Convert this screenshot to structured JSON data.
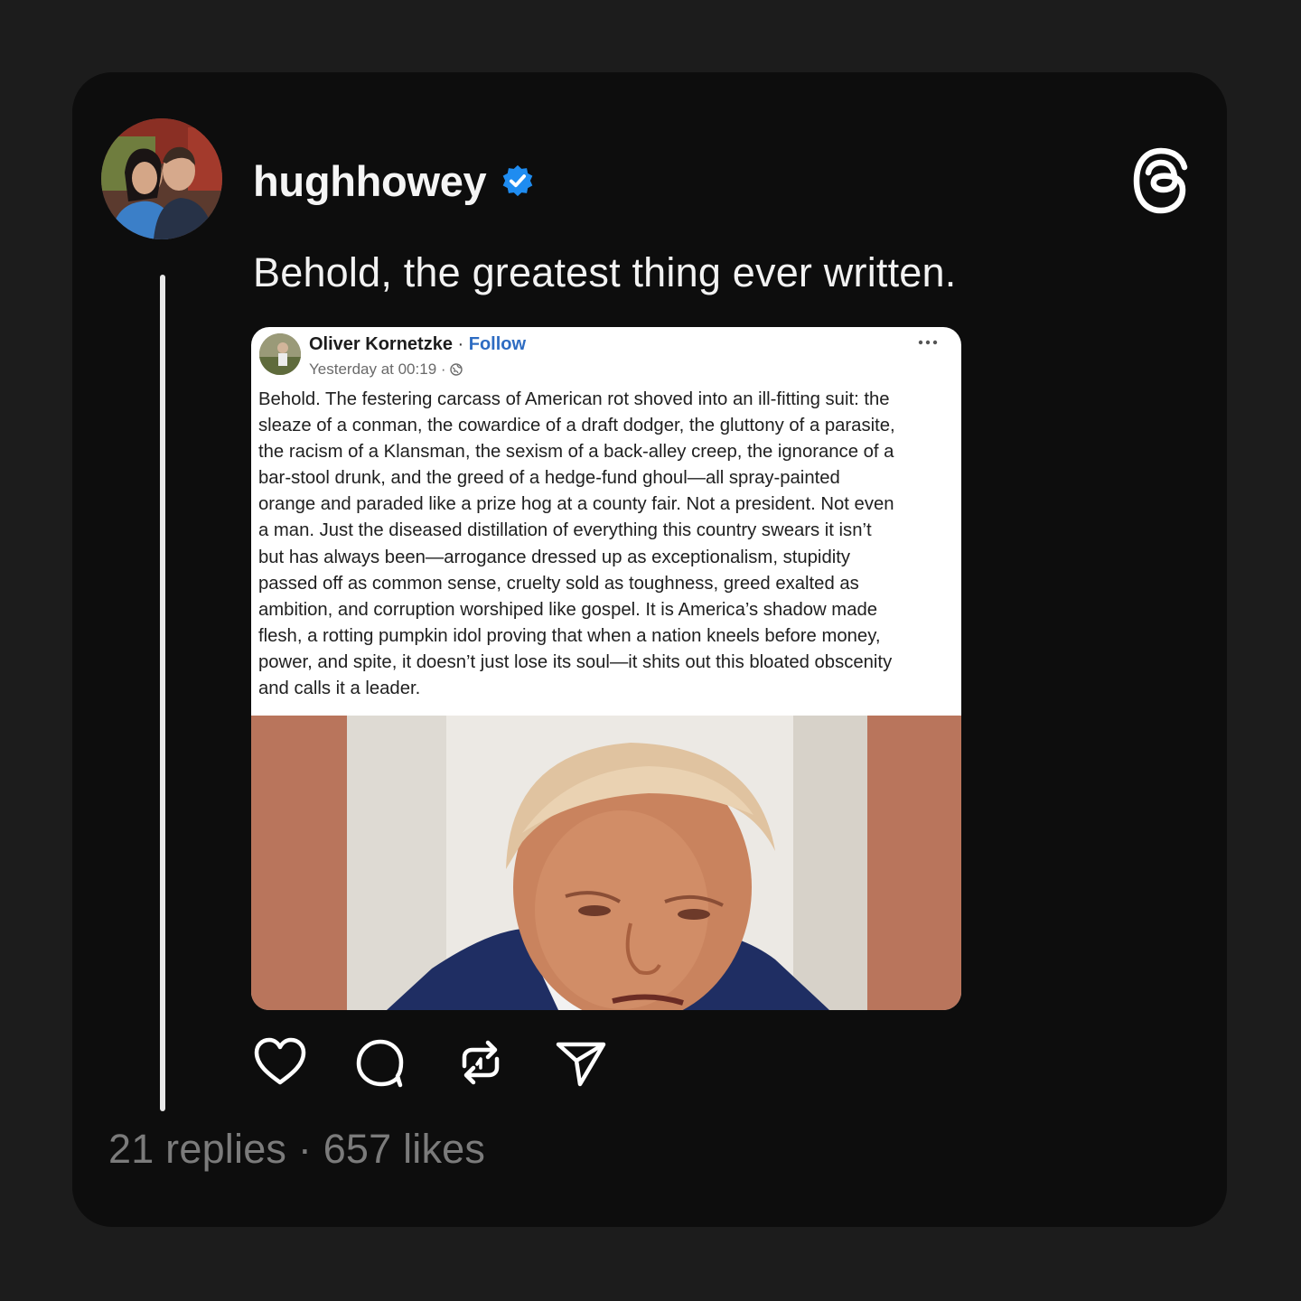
{
  "post": {
    "username": "hughhowey",
    "text": "Behold, the greatest thing ever written.",
    "stats": "21 replies · 657 likes"
  },
  "embed": {
    "author": "Oliver Kornetzke",
    "separator": " · ",
    "follow_label": "Follow",
    "timestamp": "Yesterday at 00:19 ·",
    "body": "Behold. The festering carcass of American rot shoved into an ill-fitting suit: the\nsleaze of a conman, the cowardice of a draft dodger, the gluttony of a parasite,\nthe racism of a Klansman, the sexism of a back-alley creep, the ignorance of a\nbar-stool drunk, and the greed of a hedge-fund ghoul—all spray-painted\norange and paraded like a prize hog at a county fair. Not a president. Not even\na man. Just the diseased distillation of everything this country swears it isn’t\nbut has always been—arrogance dressed up as exceptionalism, stupidity\npassed off as common sense, cruelty sold as toughness, greed exalted as\nambition, and corruption worshiped like gospel. It is America’s shadow made\nflesh, a rotting pumpkin idol proving that when a nation kneels before money,\npower, and spite, it doesn’t just lose its soul—it shits out this bloated obscenity\nand calls it a leader."
  },
  "icons": {
    "verified": "verified-badge-icon",
    "threads": "threads-logo-icon",
    "like": "heart-icon",
    "reply": "comment-icon",
    "repost": "repost-icon",
    "share": "send-icon",
    "more": "more-dots-icon",
    "audience": "globe-icon"
  },
  "colors": {
    "background": "#1c1c1c",
    "card": "#0d0d0d",
    "verified": "#1f8cf0",
    "follow_link": "#2e6cc2",
    "photo_border": "#b9755c"
  }
}
